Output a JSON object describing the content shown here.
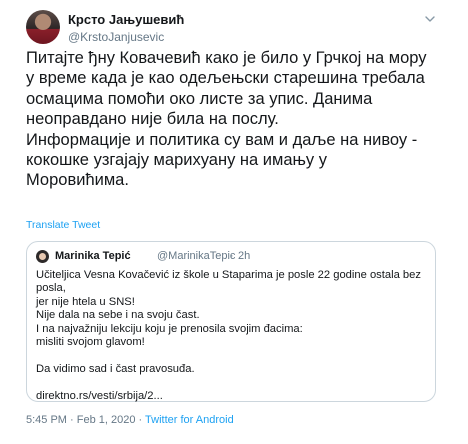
{
  "tweet": {
    "author_name": "Крсто Јањушевић",
    "author_handle": "@KrstoJanjusevic",
    "text": "Питајте ђну Ковачевић како је било у Грчкој на мору\nу време када је као одељењски старешина требала\nосмацима помоћи око листе за упис. Данима\nнеоправдано није била на послу.\nИнформације и политика су вам и даље на нивоу -\nкокошке узгајају марихуану на имању у\nМоровићима.",
    "translate_label": "Translate Tweet",
    "timestamp": "5:45 PM · Feb 1, 2020",
    "separator": "·",
    "source_app": "Twitter for Android"
  },
  "quoted": {
    "author_name": "Marinika Tepić",
    "author_handle": "@MarinikaTepic",
    "separator": "·",
    "time": "2h",
    "text": "Učiteljica Vesna Kovačević iz škole u Staparima je posle 22 godine ostala bez posla,\njer nije htela u SNS!\nNije dala na sebe i na svoju čast.\nI na najvažniju lekciju koju je prenosila svojim đacima:\nmisliti svojom glavom!\n\nDa vidimo sad i čast pravosuđa.\n\ndirektno.rs/vesti/srbija/2..."
  },
  "icons": {
    "menu": "chevron-down-icon",
    "quoted_avatar": "avatar"
  },
  "colors": {
    "link": "#1da1f2",
    "secondary_text": "#657786",
    "border": "#ccd6dd"
  }
}
